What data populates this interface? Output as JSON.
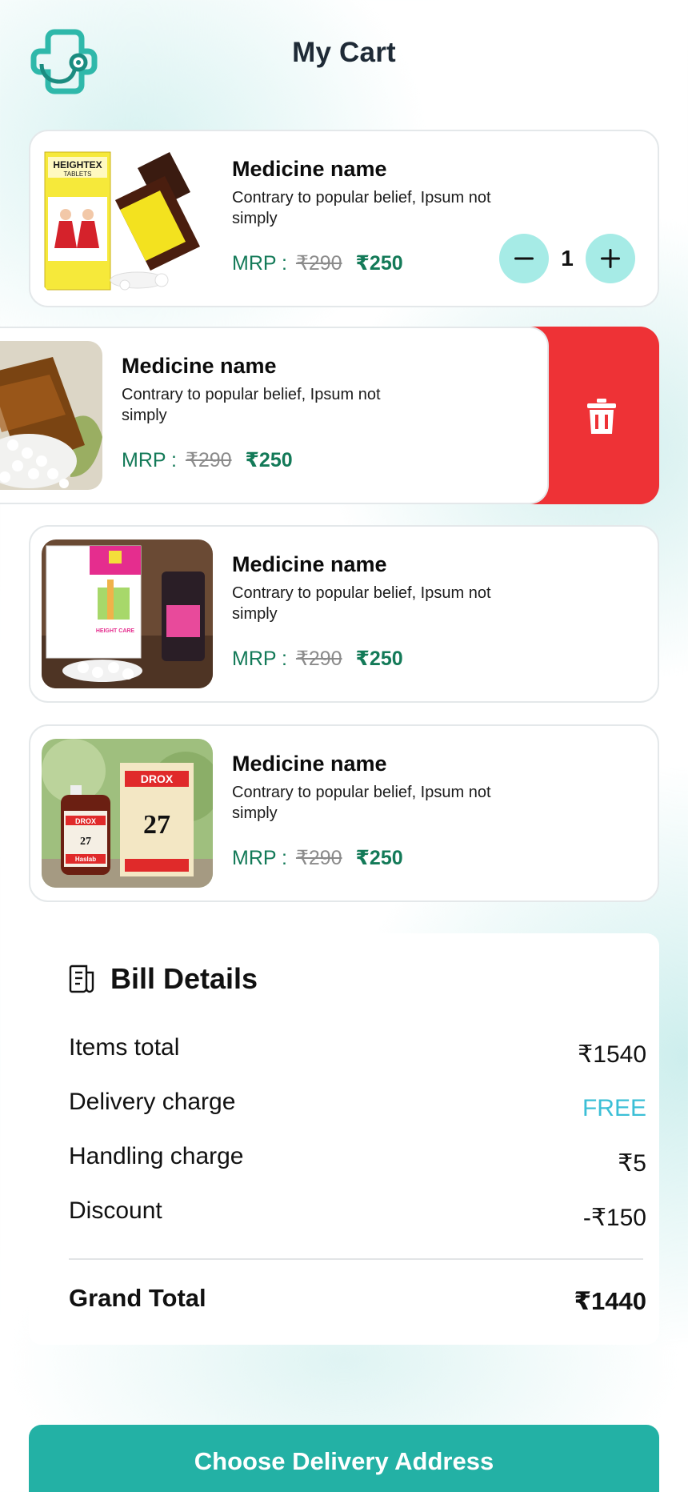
{
  "header": {
    "title": "My Cart",
    "logo_icon": "medical-cross-stethoscope-icon"
  },
  "colors": {
    "accent": "#23b1a5",
    "price": "#137a58",
    "delete": "#ee3236",
    "free": "#3bbfd6",
    "qty_button": "#a6ebe6"
  },
  "cart": {
    "items": [
      {
        "name": "Medicine name",
        "description": "Contrary to popular belief, Ipsum not simply",
        "mrp_label": "MRP :",
        "old_price": "₹290",
        "price": "₹250",
        "quantity": "1",
        "image_text": [
          "HEIGHTEX",
          "TABLETS"
        ]
      },
      {
        "name": "Medicine name",
        "description": "Contrary to popular belief, Ipsum not simply",
        "mrp_label": "MRP :",
        "old_price": "₹290",
        "price": "₹250"
      },
      {
        "name": "Medicine name",
        "description": "Contrary to popular belief, Ipsum not simply",
        "mrp_label": "MRP :",
        "old_price": "₹290",
        "price": "₹250",
        "image_text": [
          "HEIGHT CARE"
        ]
      },
      {
        "name": "Medicine name",
        "description": "Contrary to popular belief, Ipsum not simply",
        "mrp_label": "MRP :",
        "old_price": "₹290",
        "price": "₹250",
        "image_text": [
          "DROX",
          "27",
          "DROX",
          "27",
          "Haslab"
        ]
      }
    ]
  },
  "bill": {
    "title": "Bill Details",
    "rows": [
      {
        "label": "Items total",
        "value": "₹1540"
      },
      {
        "label": "Delivery charge",
        "value": "FREE"
      },
      {
        "label": "Handling charge",
        "value": "₹5"
      },
      {
        "label": "Discount",
        "value": "-₹150"
      }
    ],
    "grand_total": {
      "label": "Grand Total",
      "value": "₹1440"
    }
  },
  "cta": {
    "label": "Choose Delivery Address"
  }
}
